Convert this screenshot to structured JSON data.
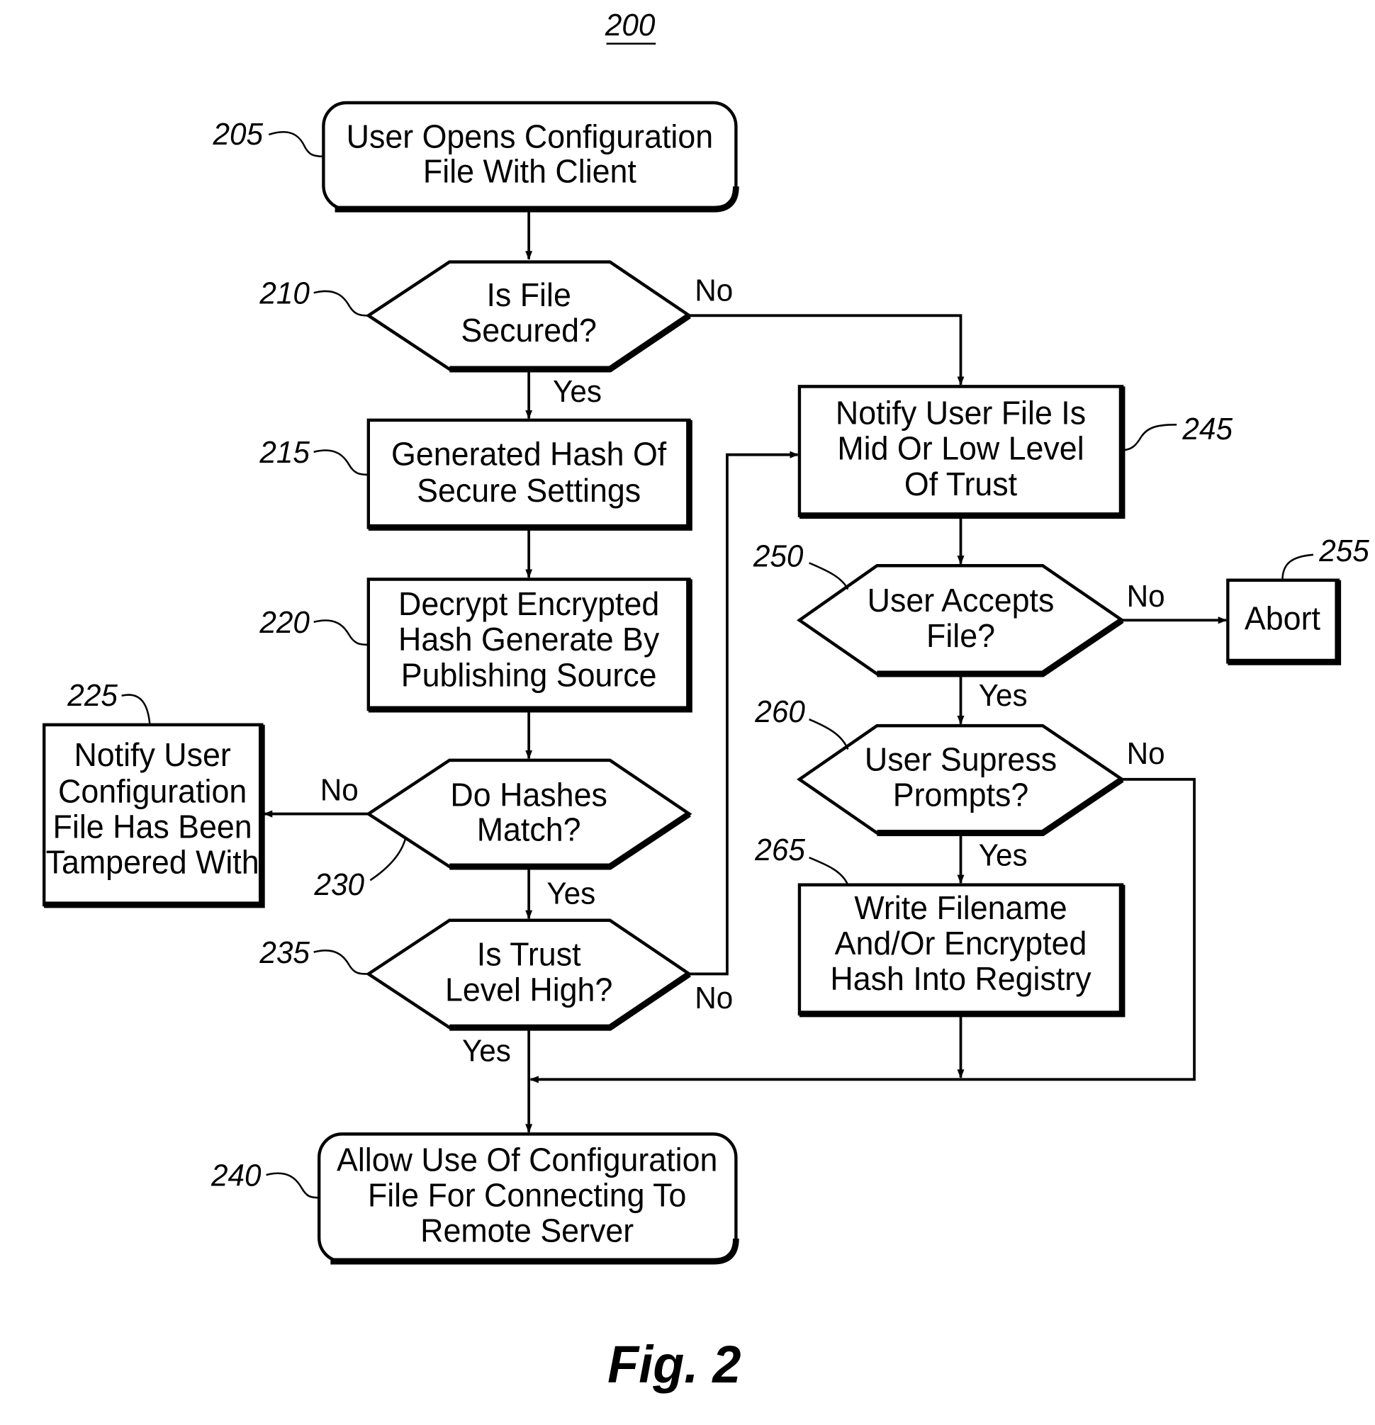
{
  "figure": {
    "number": "200",
    "caption": "Fig. 2"
  },
  "nodes": {
    "n205": {
      "ref": "205",
      "type": "terminal",
      "lines": [
        "User Opens Configuration",
        "File With Client"
      ]
    },
    "n210": {
      "ref": "210",
      "type": "decision",
      "lines": [
        "Is File",
        "Secured?"
      ]
    },
    "n215": {
      "ref": "215",
      "type": "process",
      "lines": [
        "Generated Hash Of",
        "Secure Settings"
      ]
    },
    "n220": {
      "ref": "220",
      "type": "process",
      "lines": [
        "Decrypt Encrypted",
        "Hash Generate By",
        "Publishing Source"
      ]
    },
    "n225": {
      "ref": "225",
      "type": "process",
      "lines": [
        "Notify User",
        "Configuration",
        "File Has Been",
        "Tampered With"
      ]
    },
    "n230": {
      "ref": "230",
      "type": "decision",
      "lines": [
        "Do Hashes",
        "Match?"
      ]
    },
    "n235": {
      "ref": "235",
      "type": "decision",
      "lines": [
        "Is Trust",
        "Level High?"
      ]
    },
    "n240": {
      "ref": "240",
      "type": "terminal",
      "lines": [
        "Allow Use Of Configuration",
        "File For Connecting To",
        "Remote Server"
      ]
    },
    "n245": {
      "ref": "245",
      "type": "process",
      "lines": [
        "Notify User File Is",
        "Mid Or Low Level",
        "Of Trust"
      ]
    },
    "n250": {
      "ref": "250",
      "type": "decision",
      "lines": [
        "User Accepts",
        "File?"
      ]
    },
    "n255": {
      "ref": "255",
      "type": "process",
      "lines": [
        "Abort"
      ]
    },
    "n260": {
      "ref": "260",
      "type": "decision",
      "lines": [
        "User Supress",
        "Prompts?"
      ]
    },
    "n265": {
      "ref": "265",
      "type": "process",
      "lines": [
        "Write Filename",
        "And/Or Encrypted",
        "Hash Into Registry"
      ]
    }
  },
  "edges": [
    {
      "from": "205",
      "to": "210",
      "label": ""
    },
    {
      "from": "210",
      "to": "215",
      "label": "Yes"
    },
    {
      "from": "210",
      "to": "245",
      "label": "No"
    },
    {
      "from": "215",
      "to": "220",
      "label": ""
    },
    {
      "from": "220",
      "to": "230",
      "label": ""
    },
    {
      "from": "230",
      "to": "225",
      "label": "No"
    },
    {
      "from": "230",
      "to": "235",
      "label": "Yes"
    },
    {
      "from": "235",
      "to": "240",
      "label": "Yes"
    },
    {
      "from": "235",
      "to": "245",
      "label": "No"
    },
    {
      "from": "245",
      "to": "250",
      "label": ""
    },
    {
      "from": "250",
      "to": "255",
      "label": "No"
    },
    {
      "from": "250",
      "to": "260",
      "label": "Yes"
    },
    {
      "from": "260",
      "to": "265",
      "label": "Yes"
    },
    {
      "from": "260",
      "to": "240",
      "label": "No"
    },
    {
      "from": "265",
      "to": "240",
      "label": ""
    }
  ],
  "labels": {
    "yes": "Yes",
    "no": "No"
  }
}
